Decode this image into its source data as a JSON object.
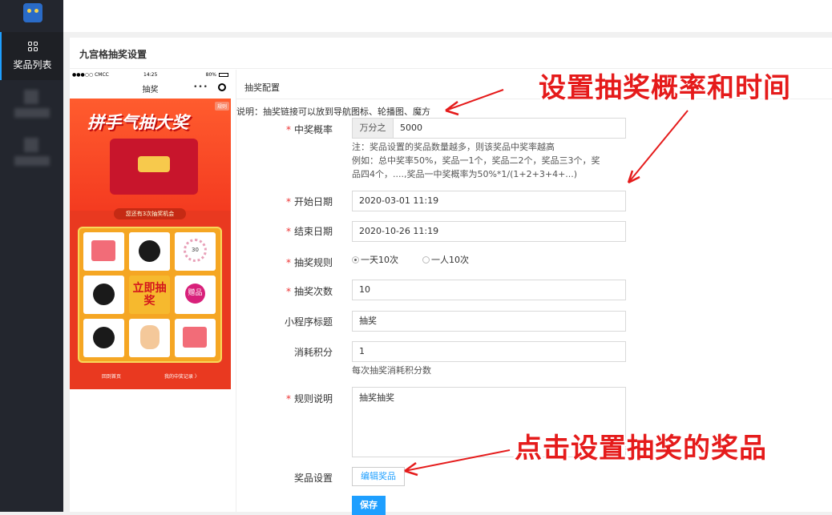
{
  "sidebar": {
    "items": [
      {
        "label": "奖品列表",
        "icon": "grid-icon",
        "active": true
      }
    ]
  },
  "panel": {
    "title": "九宫格抽奖设置"
  },
  "phone_preview": {
    "carrier": "●●●○○ CMCC",
    "time": "14:25",
    "battery": "80%",
    "title": "抽奖",
    "capsule_dots": "•••",
    "rule_tag": "规则",
    "banner": "拼手气抽大奖",
    "chance_text": "您还有3次抽奖机会",
    "center_button": "立即抽奖",
    "gift_label": "赠品",
    "ring_label": "30",
    "back_home": "回到首页",
    "my_records": "我的中奖记录 〉"
  },
  "form": {
    "section_title": "抽奖配置",
    "description": "说明：抽奖链接可以放到导航图标、轮播图、魔方",
    "probability": {
      "label": "中奖概率",
      "addon": "万分之",
      "value": "5000"
    },
    "probability_notes": [
      "注：奖品设置的奖品数量越多，则该奖品中奖率越高",
      "例如：总中奖率50%，奖品一1个，奖品二2个，奖品三3个，奖",
      "品四4个，....,奖品一中奖概率为50%*1/(1+2+3+4+...)"
    ],
    "start_date": {
      "label": "开始日期",
      "value": "2020-03-01 11:19"
    },
    "end_date": {
      "label": "结束日期",
      "value": "2020-10-26 11:19"
    },
    "rule": {
      "label": "抽奖规则",
      "options": [
        "一天10次",
        "一人10次"
      ],
      "selected": "一天10次"
    },
    "times": {
      "label": "抽奖次数",
      "value": "10"
    },
    "mini_title": {
      "label": "小程序标题",
      "value": "抽奖"
    },
    "points": {
      "label": "消耗积分",
      "value": "1",
      "note": "每次抽奖消耗积分数"
    },
    "rule_desc": {
      "label": "规则说明",
      "value": "抽奖抽奖"
    },
    "prize_settings": {
      "label": "奖品设置",
      "button": "编辑奖品"
    },
    "save": "保存"
  },
  "annotations": {
    "top": "设置抽奖概率和时间",
    "bottom": "点击设置抽奖的奖品",
    "color": "#e51b1b"
  }
}
